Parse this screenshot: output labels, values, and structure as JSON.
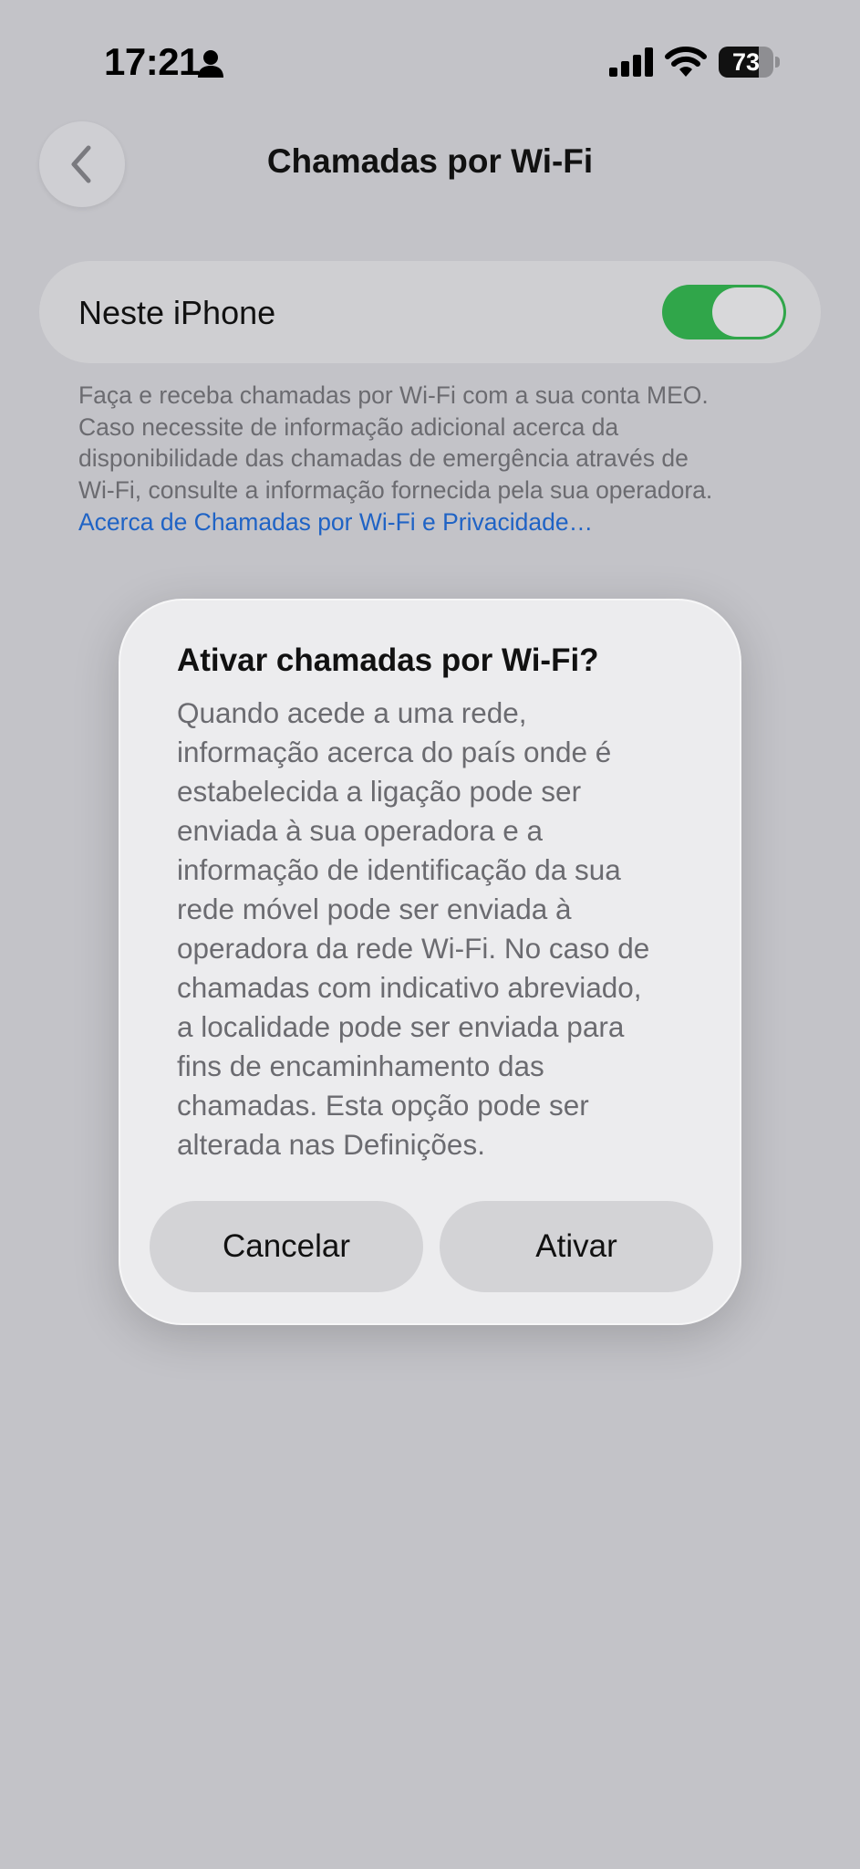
{
  "status_bar": {
    "time": "17:21",
    "battery": "73",
    "battery_level": 0.73,
    "icons": [
      "person-icon",
      "cellular-signal-icon",
      "wifi-icon",
      "battery-icon"
    ]
  },
  "nav": {
    "title": "Chamadas por Wi-Fi",
    "back_icon": "chevron-left-icon"
  },
  "setting": {
    "label": "Neste iPhone",
    "toggle_on": true,
    "toggle_color": "#30a64a"
  },
  "footer": {
    "lines": [
      "Faça e receba chamadas por Wi-Fi com a sua conta MEO.",
      "Caso necessite de informação adicional acerca da",
      "disponibilidade das chamadas de emergência através de",
      "Wi-Fi, consulte a informação fornecida pela sua operadora."
    ],
    "link": "Acerca de Chamadas por Wi-Fi e Privacidade…",
    "link_color": "#1f63c5"
  },
  "dialog": {
    "title": "Ativar chamadas por Wi-Fi?",
    "body_lines": [
      "Quando acede a uma rede,",
      "informação acerca do país onde é",
      "estabelecida a ligação pode ser",
      "enviada à sua operadora e a",
      "informação de identificação da sua",
      "rede móvel pode ser enviada à",
      "operadora da rede Wi-Fi. No caso de",
      "chamadas com indicativo abreviado,",
      "a localidade pode ser enviada para",
      "fins de encaminhamento das",
      "chamadas. Esta opção pode ser",
      "alterada nas Definições."
    ],
    "cancel_label": "Cancelar",
    "confirm_label": "Ativar"
  }
}
